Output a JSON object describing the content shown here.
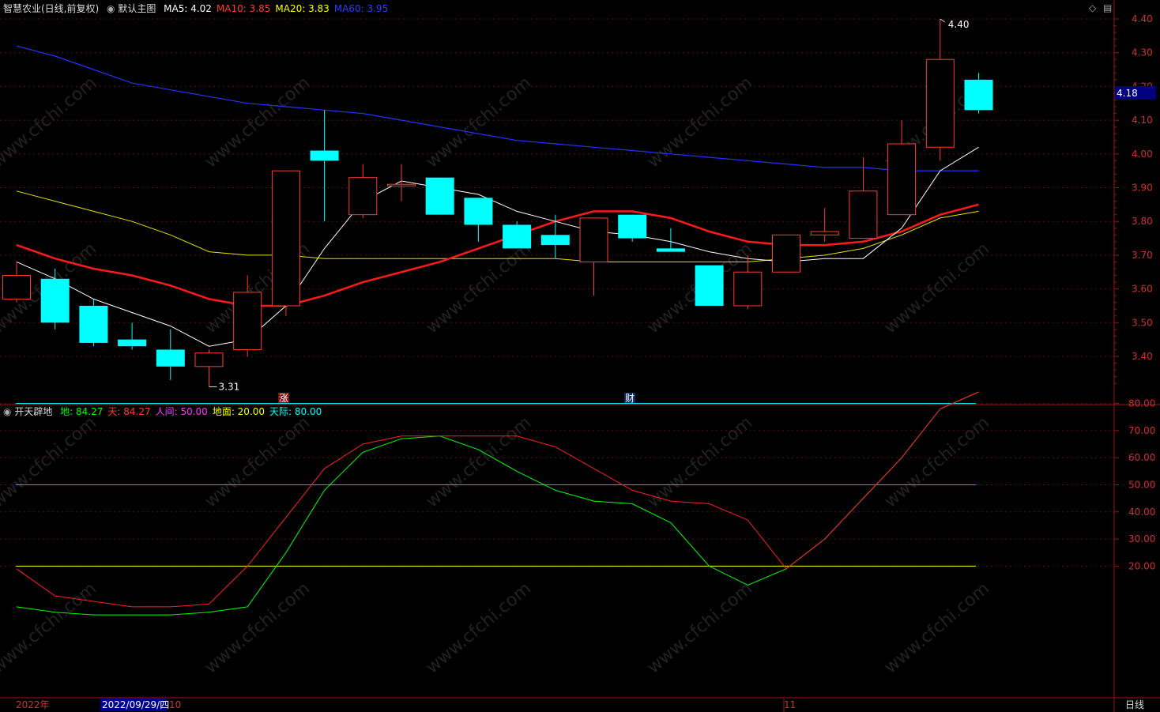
{
  "header": {
    "stock_title": "智慧农业(日线,前复权)",
    "main_chart_label": "默认主图",
    "ma_legend": [
      {
        "text": "MA5: 4.02",
        "color": "#ffffff"
      },
      {
        "text": "MA10: 3.85",
        "color": "#ff3b30"
      },
      {
        "text": "MA20: 3.83",
        "color": "#ffff00"
      },
      {
        "text": "MA60: 3.95",
        "color": "#2a3dff"
      }
    ]
  },
  "indicator_header": {
    "name": "开天辟地",
    "legend": [
      {
        "text": "地: 84.27",
        "color": "#00ff00"
      },
      {
        "text": "天: 84.27",
        "color": "#ff3b30"
      },
      {
        "text": "人间: 50.00",
        "color": "#ff33ff"
      },
      {
        "text": "地面: 20.00",
        "color": "#ffff00"
      },
      {
        "text": "天际: 80.00",
        "color": "#00ffff"
      }
    ]
  },
  "price_axis": {
    "ticks": [
      "4.40",
      "4.30",
      "4.20",
      "4.10",
      "4.00",
      "3.90",
      "3.80",
      "3.70",
      "3.60",
      "3.50",
      "3.40"
    ],
    "current_price_tag": "4.18"
  },
  "indicator_axis": {
    "ticks": [
      "80.00",
      "70.00",
      "60.00",
      "50.00",
      "40.00",
      "30.00",
      "20.00"
    ]
  },
  "annotations": {
    "high_label": "4.40",
    "low_label": "3.31",
    "event_zhang": "涨",
    "event_cai": "财"
  },
  "bottom_axis": {
    "year": "2022年",
    "cursor_date": "2022/09/29/四",
    "month_10": "10",
    "month_11": "11",
    "period_label": "日线"
  },
  "watermark": "www.cfchi.com",
  "colors": {
    "up": "#ff3b30",
    "down": "#00ffff",
    "ma5": "#ffffff",
    "ma10": "#ff1a1a",
    "ma20": "#e8e000",
    "ma60": "#2233ff",
    "axis_red": "#a01010"
  },
  "chart_data": [
    {
      "type": "candlestick",
      "title": "智慧农业(日线,前复权)",
      "ylim": [
        3.3,
        4.45
      ],
      "candles": [
        {
          "o": 3.57,
          "h": 3.68,
          "l": 3.56,
          "c": 3.64
        },
        {
          "o": 3.63,
          "h": 3.66,
          "l": 3.48,
          "c": 3.5
        },
        {
          "o": 3.55,
          "h": 3.57,
          "l": 3.43,
          "c": 3.44
        },
        {
          "o": 3.45,
          "h": 3.5,
          "l": 3.42,
          "c": 3.43
        },
        {
          "o": 3.42,
          "h": 3.48,
          "l": 3.33,
          "c": 3.37
        },
        {
          "o": 3.37,
          "h": 3.42,
          "l": 3.31,
          "c": 3.41
        },
        {
          "o": 3.42,
          "h": 3.64,
          "l": 3.4,
          "c": 3.59
        },
        {
          "o": 3.55,
          "h": 3.95,
          "l": 3.52,
          "c": 3.95
        },
        {
          "o": 4.01,
          "h": 4.13,
          "l": 3.8,
          "c": 3.98
        },
        {
          "o": 3.82,
          "h": 3.97,
          "l": 3.81,
          "c": 3.93
        },
        {
          "o": 3.91,
          "h": 3.97,
          "l": 3.86,
          "c": 3.91
        },
        {
          "o": 3.93,
          "h": 3.93,
          "l": 3.82,
          "c": 3.82
        },
        {
          "o": 3.87,
          "h": 3.87,
          "l": 3.74,
          "c": 3.79
        },
        {
          "o": 3.79,
          "h": 3.8,
          "l": 3.72,
          "c": 3.72
        },
        {
          "o": 3.76,
          "h": 3.82,
          "l": 3.69,
          "c": 3.73
        },
        {
          "o": 3.68,
          "h": 3.81,
          "l": 3.58,
          "c": 3.81
        },
        {
          "o": 3.82,
          "h": 3.82,
          "l": 3.74,
          "c": 3.75
        },
        {
          "o": 3.72,
          "h": 3.78,
          "l": 3.71,
          "c": 3.71
        },
        {
          "o": 3.67,
          "h": 3.67,
          "l": 3.55,
          "c": 3.55
        },
        {
          "o": 3.55,
          "h": 3.7,
          "l": 3.54,
          "c": 3.65
        },
        {
          "o": 3.65,
          "h": 3.76,
          "l": 3.65,
          "c": 3.76
        },
        {
          "o": 3.76,
          "h": 3.84,
          "l": 3.74,
          "c": 3.77
        },
        {
          "o": 3.75,
          "h": 3.99,
          "l": 3.75,
          "c": 3.89
        },
        {
          "o": 3.82,
          "h": 4.1,
          "l": 3.82,
          "c": 4.03
        },
        {
          "o": 4.02,
          "h": 4.4,
          "l": 3.98,
          "c": 4.28
        },
        {
          "o": 4.22,
          "h": 4.24,
          "l": 4.12,
          "c": 4.13
        }
      ],
      "ma5": [
        3.68,
        3.63,
        3.57,
        3.53,
        3.49,
        3.43,
        3.45,
        3.55,
        3.72,
        3.86,
        3.92,
        3.9,
        3.88,
        3.83,
        3.8,
        3.77,
        3.76,
        3.74,
        3.71,
        3.69,
        3.68,
        3.69,
        3.69,
        3.78,
        3.95,
        4.02
      ],
      "ma10": [
        3.73,
        3.69,
        3.66,
        3.64,
        3.61,
        3.57,
        3.55,
        3.55,
        3.58,
        3.62,
        3.65,
        3.68,
        3.72,
        3.76,
        3.8,
        3.83,
        3.83,
        3.81,
        3.77,
        3.74,
        3.73,
        3.73,
        3.74,
        3.77,
        3.82,
        3.85
      ],
      "ma20": [
        3.89,
        3.86,
        3.83,
        3.8,
        3.76,
        3.71,
        3.7,
        3.7,
        3.69,
        3.69,
        3.69,
        3.69,
        3.69,
        3.69,
        3.69,
        3.68,
        3.68,
        3.68,
        3.68,
        3.68,
        3.69,
        3.7,
        3.72,
        3.76,
        3.81,
        3.83
      ],
      "ma60": [
        4.32,
        4.29,
        4.25,
        4.21,
        4.19,
        4.17,
        4.15,
        4.14,
        4.13,
        4.12,
        4.1,
        4.08,
        4.06,
        4.04,
        4.03,
        4.02,
        4.01,
        4.0,
        3.99,
        3.98,
        3.97,
        3.96,
        3.96,
        3.95,
        3.95,
        3.95
      ]
    },
    {
      "type": "line",
      "title": "开天辟地",
      "ylim": [
        0,
        89
      ],
      "series": [
        {
          "name": "地",
          "values": [
            5,
            3,
            2,
            2,
            2,
            3,
            5,
            25,
            48,
            62,
            67,
            68,
            63,
            55,
            48,
            44,
            43,
            36,
            20,
            13,
            19,
            30,
            45,
            60,
            78,
            84.27
          ]
        },
        {
          "name": "天",
          "values": [
            19,
            9,
            7,
            5,
            5,
            6,
            20,
            38,
            56,
            65,
            68,
            68,
            68,
            68,
            64,
            56,
            48,
            44,
            43,
            37,
            19,
            30,
            45,
            60,
            78,
            84.27
          ]
        }
      ],
      "reference_lines": [
        {
          "name": "人间",
          "value": 50
        },
        {
          "name": "地面",
          "value": 20
        },
        {
          "name": "天际",
          "value": 80
        }
      ]
    }
  ]
}
